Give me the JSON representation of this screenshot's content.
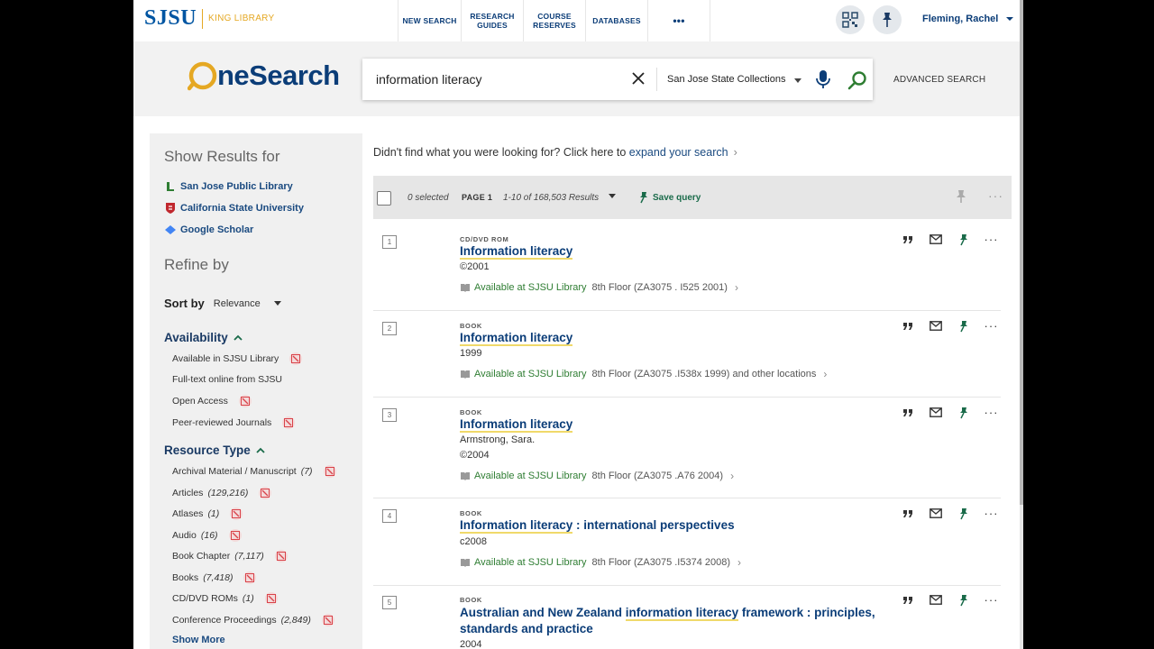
{
  "nav": {
    "logo_main": "SJSU",
    "logo_sub": "KING LIBRARY",
    "items": [
      {
        "line1": "NEW SEARCH",
        "line2": ""
      },
      {
        "line1": "RESEARCH",
        "line2": "GUIDES"
      },
      {
        "line1": "COURSE",
        "line2": "RESERVES"
      },
      {
        "line1": "DATABASES",
        "line2": ""
      },
      {
        "line1": "•••",
        "line2": ""
      }
    ],
    "user": "Fleming, Rachel"
  },
  "search": {
    "brand": "neSearch",
    "query": "information literacy",
    "scope": "San Jose State Collections",
    "advanced": "ADVANCED SEARCH"
  },
  "sidebar": {
    "show_results_heading": "Show Results for",
    "links": [
      "San Jose Public Library",
      "California State University",
      "Google Scholar"
    ],
    "refine_heading": "Refine by",
    "sort_label": "Sort by",
    "sort_value": "Relevance",
    "availability_heading": "Availability",
    "availability": [
      "Available in SJSU Library",
      "Full-text online from SJSU",
      "Open Access",
      "Peer-reviewed Journals"
    ],
    "resource_heading": "Resource Type",
    "resource_types": [
      {
        "label": "Archival Material / Manuscript",
        "count": "(7)"
      },
      {
        "label": "Articles",
        "count": "(129,216)"
      },
      {
        "label": "Atlases",
        "count": "(1)"
      },
      {
        "label": "Audio",
        "count": "(16)"
      },
      {
        "label": "Book Chapter",
        "count": "(7,117)"
      },
      {
        "label": "Books",
        "count": "(7,418)"
      },
      {
        "label": "CD/DVD ROMs",
        "count": "(1)"
      },
      {
        "label": "Conference Proceedings",
        "count": "(2,849)"
      }
    ],
    "show_more": "Show More"
  },
  "main": {
    "expand_text": "Didn't find what you were looking for? Click here to ",
    "expand_link": "expand your search",
    "toolbar": {
      "selected": "0 selected",
      "page": "PAGE 1",
      "range": "1-10 of 168,503 Results",
      "save": "Save query"
    },
    "results": [
      {
        "num": "1",
        "type": "CD/DVD ROM",
        "title_hl": "Information literacy",
        "title_rest": "",
        "lines": [
          "©2001"
        ],
        "avail": "Available at SJSU Library",
        "loc": "8th Floor (ZA3075 . I525 2001)"
      },
      {
        "num": "2",
        "type": "BOOK",
        "title_hl": "Information literacy",
        "title_rest": "",
        "lines": [
          "1999"
        ],
        "avail": "Available at SJSU Library",
        "loc": "8th Floor (ZA3075 .I538x 1999) and other locations"
      },
      {
        "num": "3",
        "type": "BOOK",
        "title_hl": "Information literacy",
        "title_rest": "",
        "lines": [
          "Armstrong, Sara.",
          "©2004"
        ],
        "avail": "Available at SJSU Library",
        "loc": "8th Floor (ZA3075 .A76 2004)"
      },
      {
        "num": "4",
        "type": "BOOK",
        "title_hl": "Information literacy",
        "title_rest": " : international perspectives",
        "lines": [
          "c2008"
        ],
        "avail": "Available at SJSU Library",
        "loc": "8th Floor (ZA3075 .I5374 2008)"
      },
      {
        "num": "5",
        "type": "BOOK",
        "title_pre": "Australian and New Zealand ",
        "title_hl": "information literacy",
        "title_rest": " framework : principles, standards and practice",
        "lines": [
          "2004"
        ]
      }
    ]
  },
  "colors": {
    "navy": "#0b3d78",
    "green": "#2e7d32",
    "gold": "#e5a823",
    "red_x": "#d9434a"
  }
}
